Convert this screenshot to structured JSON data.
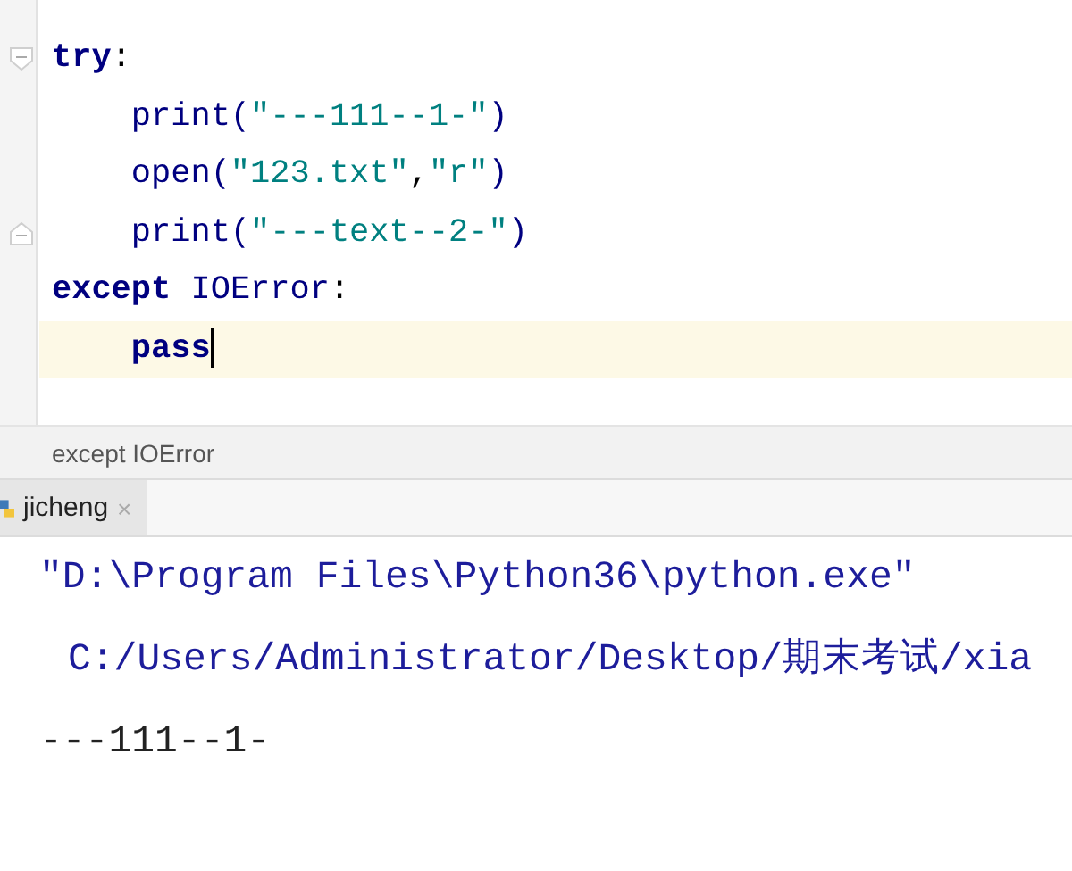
{
  "editor": {
    "lines": [
      {
        "fold_open": true,
        "fold_close": false,
        "current": false,
        "tokens": [
          {
            "kind": "keyword",
            "text": "try"
          },
          {
            "kind": "plain",
            "text": ":"
          }
        ],
        "children": [
          {
            "fold_open": false,
            "fold_close": false,
            "current": false,
            "tokens": [
              {
                "kind": "call",
                "text": "print("
              },
              {
                "kind": "string",
                "text": "\"---111--1-\""
              },
              {
                "kind": "call",
                "text": ")"
              }
            ]
          },
          {
            "fold_open": false,
            "fold_close": false,
            "current": false,
            "tokens": [
              {
                "kind": "call",
                "text": "open("
              },
              {
                "kind": "string",
                "text": "\"123.txt\""
              },
              {
                "kind": "plain",
                "text": ","
              },
              {
                "kind": "string",
                "text": "\"r\""
              },
              {
                "kind": "call",
                "text": ")"
              }
            ]
          },
          {
            "fold_open": false,
            "fold_close": true,
            "current": false,
            "tokens": [
              {
                "kind": "call",
                "text": "print("
              },
              {
                "kind": "string",
                "text": "\"---text--2-\""
              },
              {
                "kind": "call",
                "text": ")"
              }
            ]
          }
        ]
      },
      {
        "fold_open": false,
        "fold_close": false,
        "current": false,
        "tokens": [
          {
            "kind": "keyword",
            "text": "except"
          },
          {
            "kind": "call",
            "text": "IOError",
            "space_before": true
          },
          {
            "kind": "plain",
            "text": ":"
          }
        ],
        "children": [
          {
            "fold_open": false,
            "fold_close": false,
            "current": true,
            "tokens": [
              {
                "kind": "keyword",
                "text": "pass"
              }
            ]
          }
        ]
      }
    ]
  },
  "breadcrumb": "except IOError",
  "run_tabs": [
    {
      "label": "jicheng",
      "selected": true,
      "close_glyph": "×"
    }
  ],
  "console": [
    {
      "kind": "command",
      "text": "\"D:\\Program Files\\Python36\\python.exe\""
    },
    {
      "kind": "path",
      "text": "C:/Users/Administrator/Desktop/期末考试/xia"
    },
    {
      "kind": "output",
      "text": "---111--1-"
    }
  ]
}
